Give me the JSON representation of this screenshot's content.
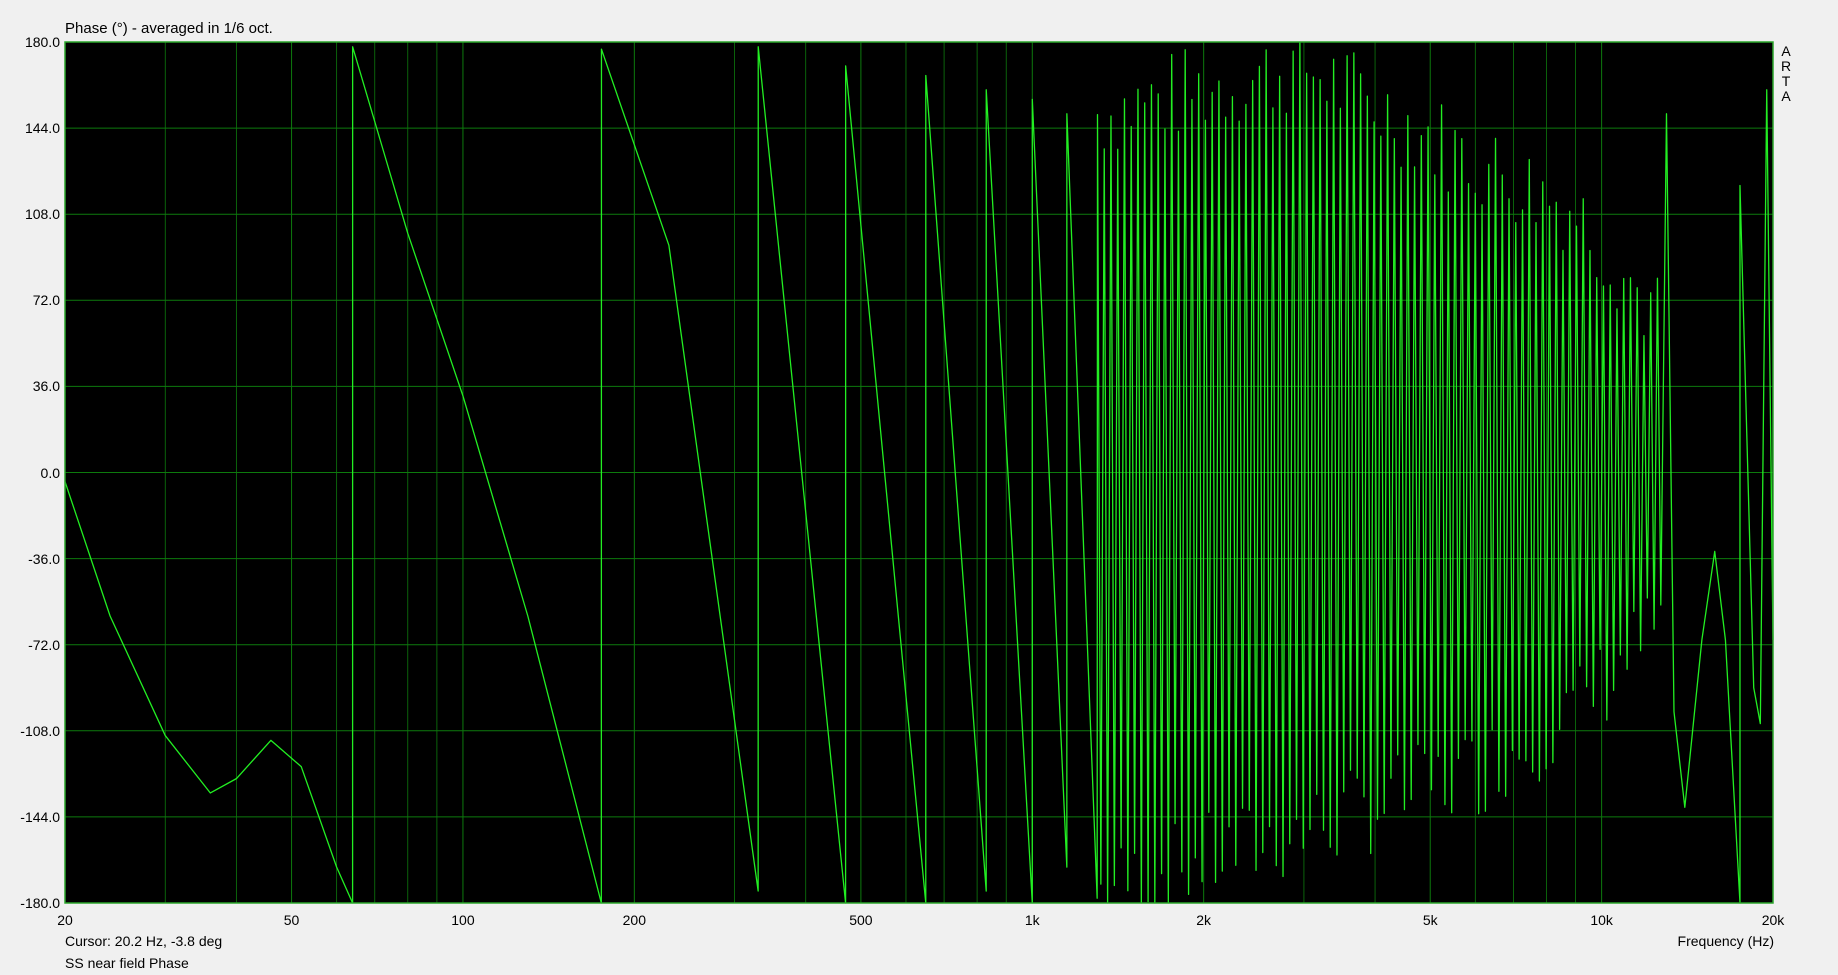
{
  "chart_data": {
    "type": "line",
    "title": "Phase (°) - averaged in 1/6 oct.",
    "xlabel": "Frequency (Hz)",
    "ylabel": "",
    "xscale": "log",
    "xlim": [
      20,
      20000
    ],
    "ylim": [
      -180,
      180
    ],
    "grid": true,
    "colors": {
      "trace": "#22ee22",
      "grid": "#0d7a0d",
      "background": "#000000",
      "frame": "#2aa52a"
    },
    "y_ticks": [
      "180.0",
      "144.0",
      "108.0",
      "72.0",
      "36.0",
      "0.0",
      "-36.0",
      "-72.0",
      "-108.0",
      "-144.0",
      "-180.0"
    ],
    "y_tick_values": [
      180,
      144,
      108,
      72,
      36,
      0,
      -36,
      -72,
      -108,
      -144,
      -180
    ],
    "x_ticks": [
      "20",
      "50",
      "100",
      "200",
      "500",
      "1k",
      "2k",
      "5k",
      "10k",
      "20k"
    ],
    "x_tick_values": [
      20,
      50,
      100,
      200,
      500,
      1000,
      2000,
      5000,
      10000,
      20000
    ],
    "x_minor_grid": [
      30,
      40,
      60,
      70,
      80,
      90,
      300,
      400,
      600,
      700,
      800,
      900,
      3000,
      4000,
      6000,
      7000,
      8000,
      9000
    ],
    "series": [
      {
        "points": [
          [
            20,
            -3.8
          ],
          [
            24,
            -60
          ],
          [
            30,
            -110
          ],
          [
            36,
            -134
          ],
          [
            40,
            -128
          ],
          [
            46,
            -112
          ],
          [
            52,
            -123
          ],
          [
            60,
            -165
          ],
          [
            64,
            -180
          ],
          [
            64.01,
            178
          ],
          [
            80,
            100
          ],
          [
            100,
            32
          ],
          [
            130,
            -60
          ],
          [
            175,
            -180
          ],
          [
            175.1,
            177
          ],
          [
            230,
            95
          ],
          [
            330,
            -175
          ],
          [
            330.1,
            178
          ],
          [
            470,
            -180
          ],
          [
            470.1,
            170
          ],
          [
            650,
            -180
          ],
          [
            650.1,
            166
          ],
          [
            830,
            -175
          ],
          [
            830.1,
            160
          ],
          [
            1000,
            -180
          ],
          [
            1000.1,
            156
          ],
          [
            1150,
            -165
          ],
          [
            1150.1,
            150
          ],
          [
            1300,
            -178
          ]
        ]
      }
    ],
    "oscillation": {
      "from_hz": 1300,
      "to_hz": 16000,
      "cycles": 92,
      "peaks": [
        150,
        170,
        130,
        110,
        60
      ],
      "troughs": [
        -175,
        -150,
        -125,
        -100,
        -60
      ],
      "anchor_hz": [
        1300,
        3000,
        6000,
        9000,
        13000
      ]
    },
    "tail": [
      [
        13000,
        150
      ],
      [
        13400,
        -100
      ],
      [
        14000,
        -140
      ],
      [
        15000,
        -70
      ],
      [
        15800,
        -33
      ],
      [
        16500,
        -70
      ],
      [
        17500,
        -180
      ],
      [
        17500.1,
        120
      ],
      [
        18500,
        -90
      ],
      [
        19000,
        -105
      ],
      [
        19500,
        160
      ],
      [
        20000,
        -70
      ]
    ],
    "cursor": {
      "text": "Cursor: 20.2 Hz, -3.8 deg"
    },
    "measurement_name": "SS near field Phase"
  },
  "brand_letters": [
    "A",
    "R",
    "T",
    "A"
  ]
}
